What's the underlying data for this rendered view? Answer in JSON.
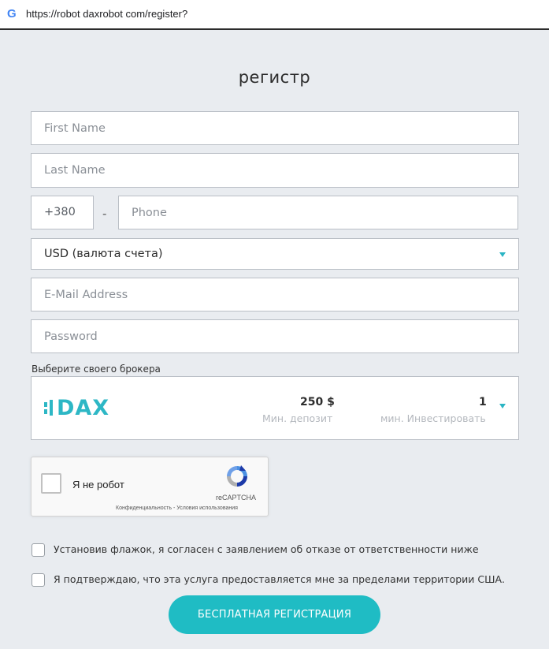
{
  "browser": {
    "url": "https://robot daxrobot com/register?",
    "search_engine_icon": "google-g-icon"
  },
  "form": {
    "title": "регистр",
    "first_name_placeholder": "First Name",
    "last_name_placeholder": "Last Name",
    "phone_code": "+380",
    "phone_separator": "-",
    "phone_placeholder": "Phone",
    "currency_selected": "USD (валюта счета)",
    "email_placeholder": "E-Mail Address",
    "password_placeholder": "Password"
  },
  "broker": {
    "label": "Выберите своего брокера",
    "logo_text": "DAX",
    "min_deposit_value": "250 $",
    "min_deposit_caption": "Мин. депозит",
    "min_invest_value": "1",
    "min_invest_caption": "мин. Инвестировать"
  },
  "captcha": {
    "label": "Я не робот",
    "brand": "reCAPTCHA",
    "links": "Конфиденциальность - Условия использования"
  },
  "agreements": [
    {
      "text": "Установив флажок, я согласен с заявлением об отказе от ответственности ниже",
      "checked": false
    },
    {
      "text": "Я подтверждаю, что эта услуга предоставляется мне за пределами территории США.",
      "checked": false
    }
  ],
  "submit_label": "БЕСПЛАТНАЯ РЕГИСТРАЦИЯ",
  "colors": {
    "accent": "#1fbcc4",
    "background": "#e9ecf0"
  }
}
